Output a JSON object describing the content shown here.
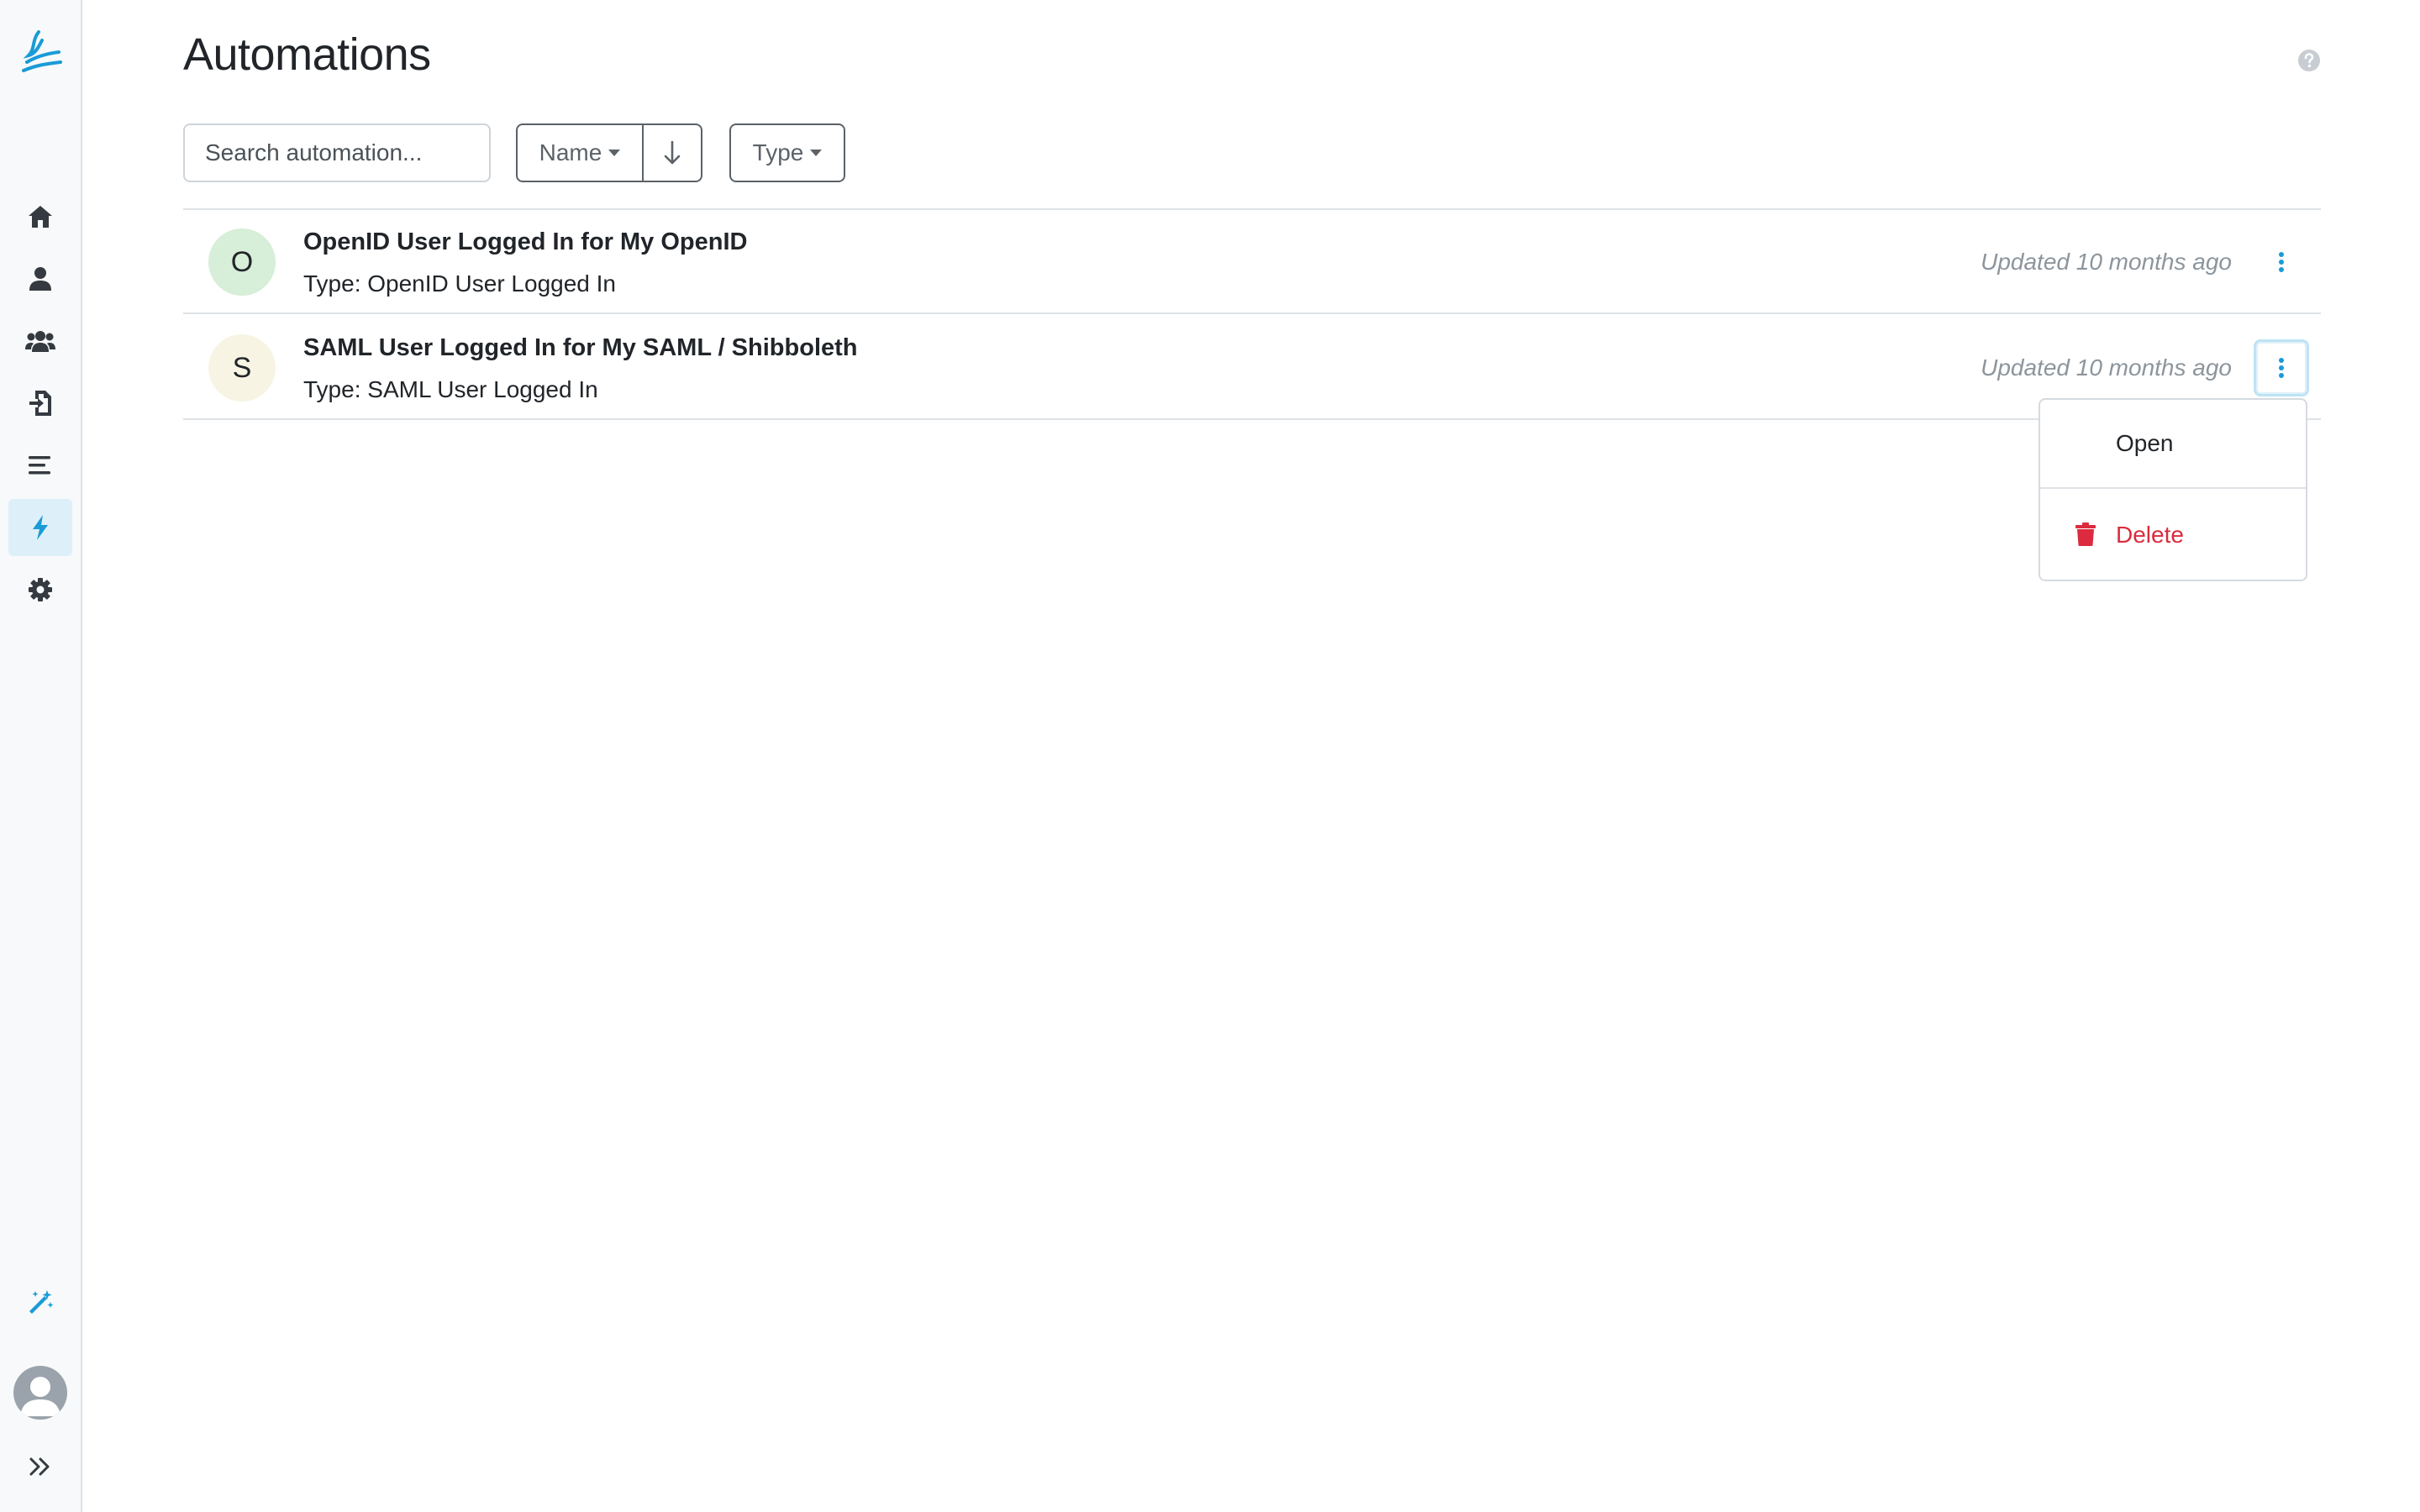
{
  "page": {
    "title": "Automations",
    "help_icon": "question-circle-icon"
  },
  "sidebar": {
    "logo_icon": "app-logo-icon",
    "items": [
      {
        "name": "home",
        "icon": "home-icon",
        "active": false
      },
      {
        "name": "users",
        "icon": "user-icon",
        "active": false
      },
      {
        "name": "groups",
        "icon": "users-icon",
        "active": false
      },
      {
        "name": "applications",
        "icon": "sign-in-icon",
        "active": false
      },
      {
        "name": "logs",
        "icon": "list-icon",
        "active": false
      },
      {
        "name": "automations",
        "icon": "bolt-icon",
        "active": true
      },
      {
        "name": "settings",
        "icon": "gear-icon",
        "active": false
      }
    ],
    "bottom": [
      "magic-wand-icon",
      "avatar",
      "expand-chevrons-icon"
    ]
  },
  "toolbar": {
    "search_placeholder": "Search automation...",
    "search_value": "",
    "sort_label": "Name",
    "sort_direction_icon": "arrow-down-icon",
    "type_label": "Type"
  },
  "automations": [
    {
      "initial": "O",
      "avatar_color": "#d7eed8",
      "title": "OpenID User Logged In for My OpenID",
      "subtitle": "Type: OpenID User Logged In",
      "updated": "Updated 10 months ago"
    },
    {
      "initial": "S",
      "avatar_color": "#f7f4e4",
      "title": "SAML User Logged In for My SAML / Shibboleth",
      "subtitle": "Type: SAML User Logged In",
      "updated": "Updated 10 months ago"
    }
  ],
  "menu": {
    "open_label": "Open",
    "delete_label": "Delete"
  },
  "colors": {
    "accent": "#1a9bd7",
    "danger": "#dc2b3e",
    "muted": "#8d959c"
  }
}
